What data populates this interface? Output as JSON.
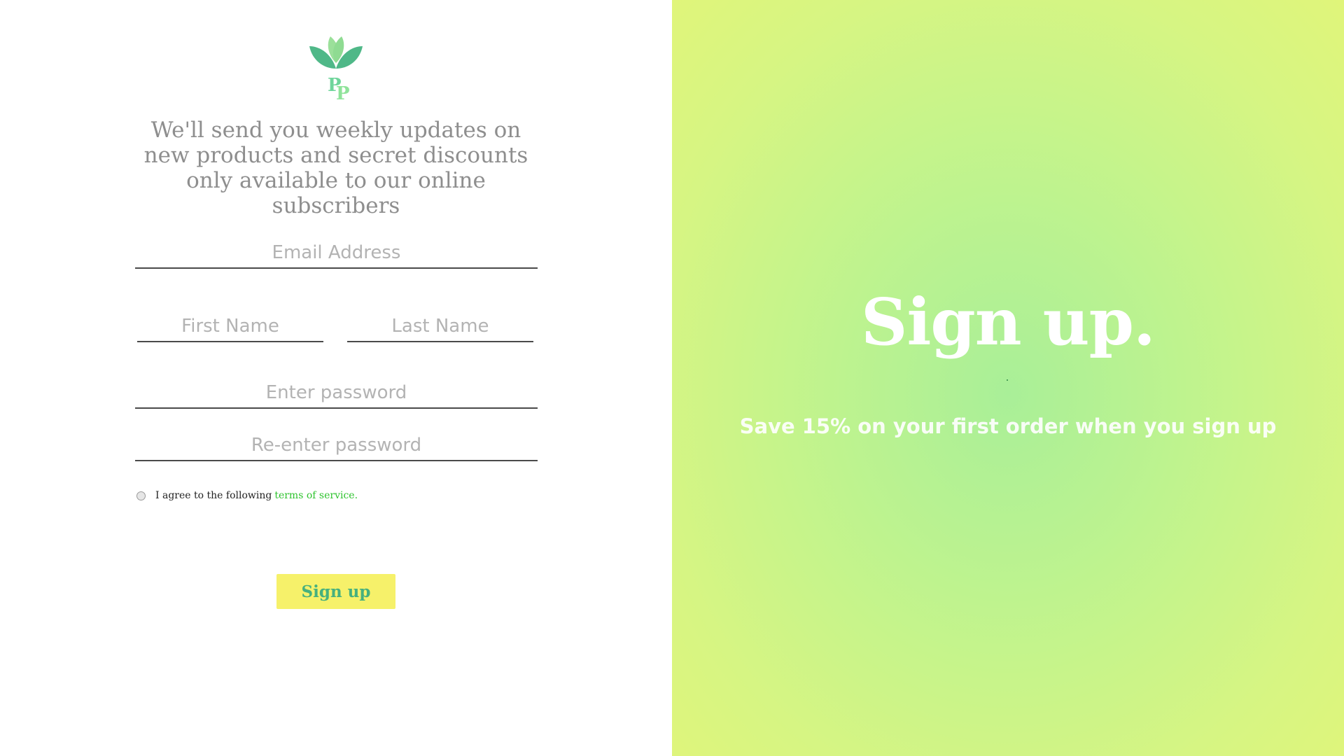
{
  "brand": {
    "logo_icon": "lotus-leaf-pp-logo-icon",
    "logo_letters": "PP",
    "colors": {
      "leaf_dark": "#4fb888",
      "leaf_light": "#9be09a",
      "letters": "#6fd59b"
    }
  },
  "form": {
    "tagline": "We'll send you weekly updates on new products and secret discounts only available to our online subscribers",
    "email_placeholder": "Email Address",
    "first_name_placeholder": "First Name",
    "last_name_placeholder": "Last Name",
    "password_placeholder": "Enter password",
    "repassword_placeholder": "Re-enter password",
    "terms_text": "I agree to the following",
    "terms_link": "terms of service.",
    "terms_checked": false,
    "submit_label": "Sign up",
    "submit_bg": "#f6f16a",
    "submit_text_color": "#46b07e"
  },
  "hero": {
    "title": "Sign up.",
    "subtitle": "Save 15% on your first order when you sign up",
    "gradient_colors": [
      "#a9ef98",
      "#e0f57a"
    ]
  }
}
